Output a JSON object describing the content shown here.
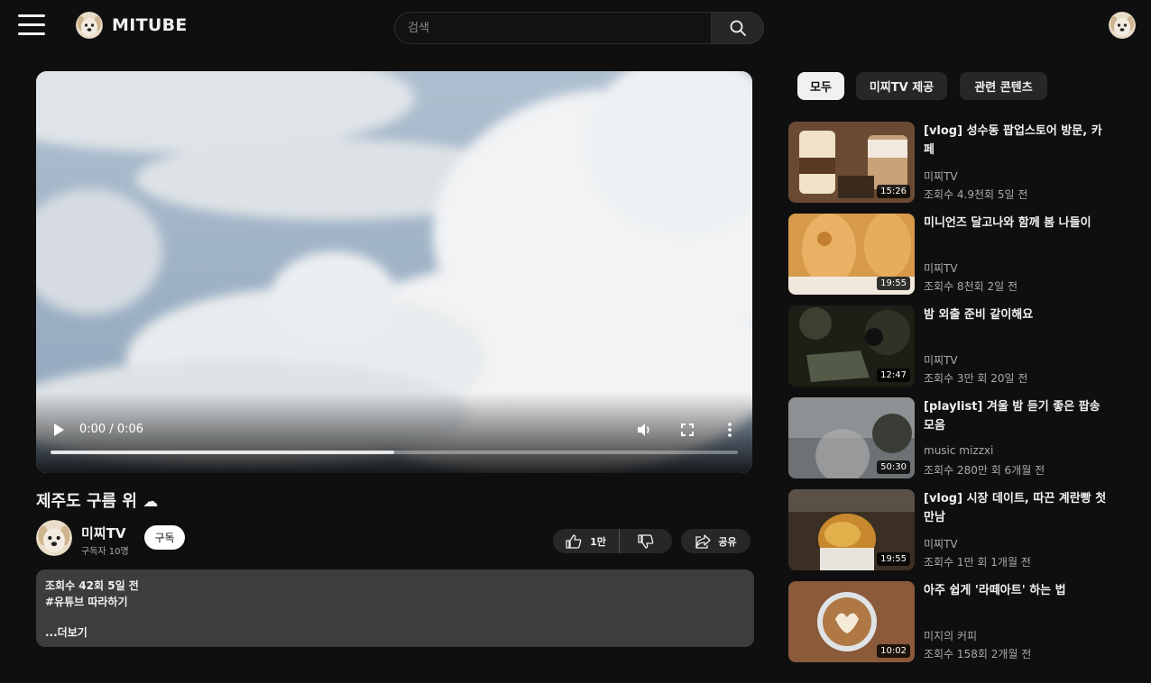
{
  "header": {
    "logo_text": "MITUBE",
    "search_placeholder": "검색"
  },
  "player": {
    "time": "0:00 / 0:06",
    "progress": 0.5
  },
  "video": {
    "title": "제주도 구름 위",
    "title_emoji": "☁",
    "channel": "미찌TV",
    "subscribers": "구독자 10명",
    "subscribe_label": "구독",
    "likes": "1만",
    "share_label": "공유",
    "description": {
      "meta": "조회수 42회 5일 전",
      "tag": "#유튜브 따라하기",
      "more_label": "...더보기"
    }
  },
  "chips": [
    "모두",
    "미찌TV 제공",
    "관련 콘텐츠"
  ],
  "related": [
    {
      "title": "[vlog] 성수동 팝업스토어 방문, 카페",
      "channel": "미찌TV",
      "meta": "조회수 4.9천회 5일 전",
      "duration": "15:26",
      "thumb_color": "#6b4a33"
    },
    {
      "title": "미니언즈 달고나와 함께 봄 나들이",
      "channel": "미찌TV",
      "meta": "조회수 8천회 2일 전",
      "duration": "19:55",
      "thumb_color": "#d79a4a"
    },
    {
      "title": "밤 외출 준비 같이해요",
      "channel": "미찌TV",
      "meta": "조회수 3만 회 20일 전",
      "duration": "12:47",
      "thumb_color": "#2b2e22"
    },
    {
      "title": "[playlist] 겨울 밤 듣기 좋은 팝송 모음",
      "channel": "music mizzxi",
      "meta": "조회수 280만 회 6개월 전",
      "duration": "50:30",
      "thumb_color": "#6f7275"
    },
    {
      "title": "[vlog] 시장 데이트, 따끈 계란빵 첫만남",
      "channel": "미찌TV",
      "meta": "조회수 1만 회 1개월 전",
      "duration": "19:55",
      "thumb_color": "#3a2f22"
    },
    {
      "title": "아주 쉽게 '라떼아트' 하는 법",
      "channel": "미지의 커피",
      "meta": "조회수 158회 2개월 전",
      "duration": "10:02",
      "thumb_color": "#8a5a3a"
    }
  ]
}
